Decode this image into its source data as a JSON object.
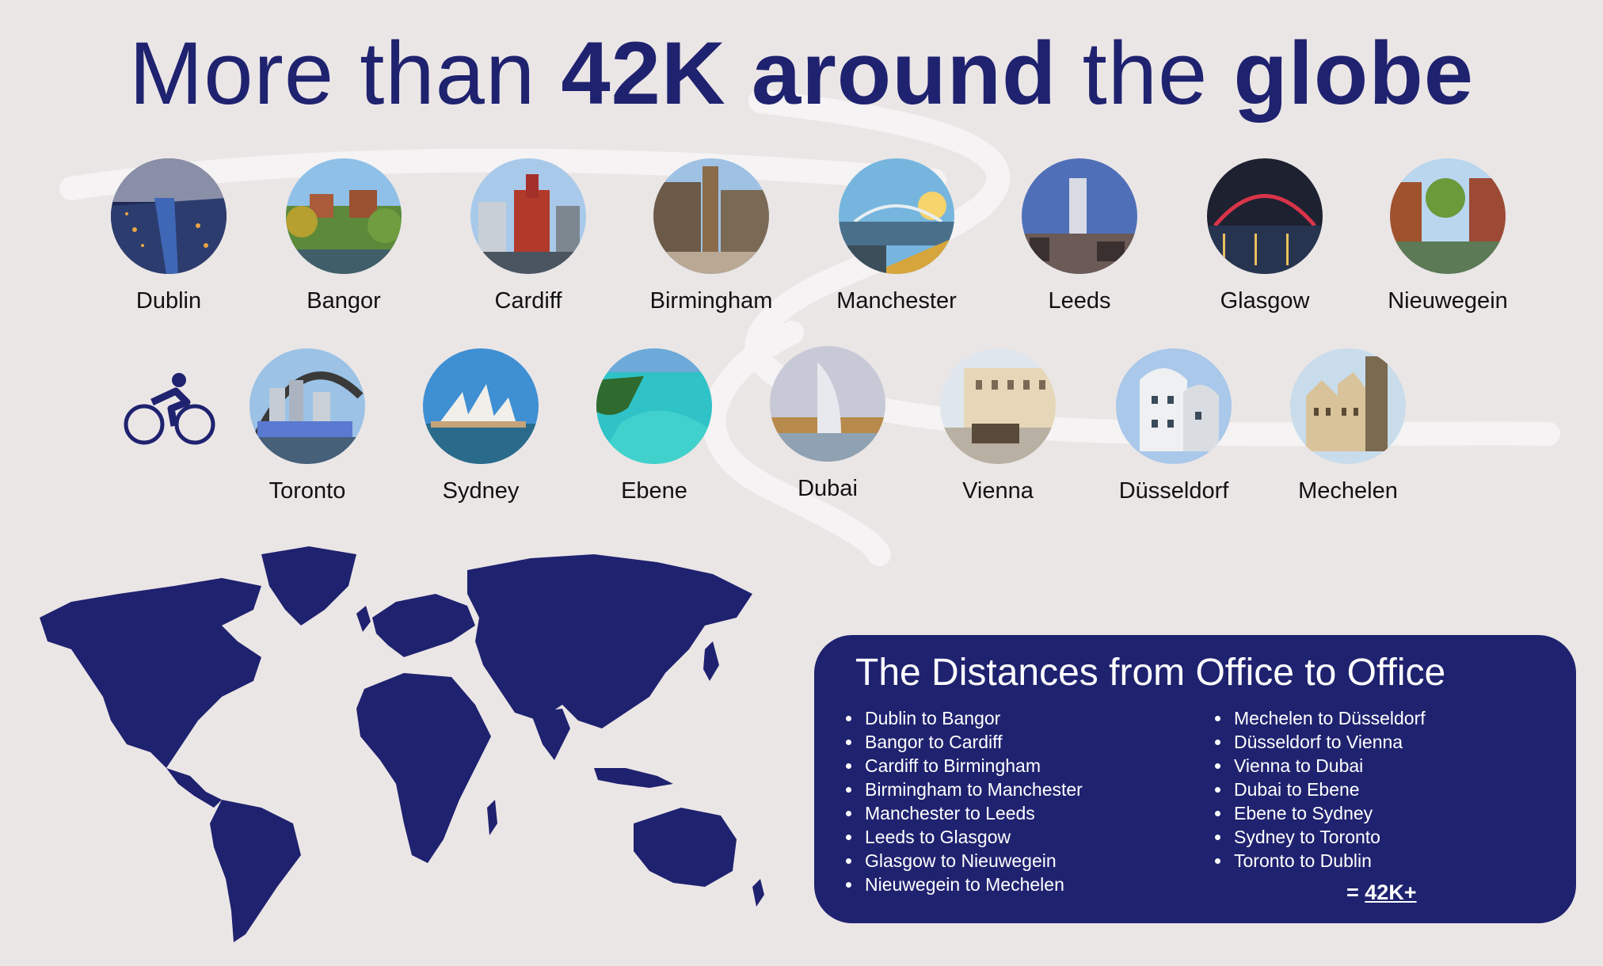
{
  "header": {
    "part1": "More than ",
    "bold1": "42K around",
    "part2": " the ",
    "bold2": "globe"
  },
  "cities_row1": [
    {
      "label": "Dublin",
      "photo": "dublin-photo"
    },
    {
      "label": "Bangor",
      "photo": "bangor-photo"
    },
    {
      "label": "Cardiff",
      "photo": "cardiff-photo"
    },
    {
      "label": "Birmingham",
      "photo": "birmingham-photo"
    },
    {
      "label": "Manchester",
      "photo": "manchester-photo"
    },
    {
      "label": "Leeds",
      "photo": "leeds-photo"
    },
    {
      "label": "Glasgow",
      "photo": "glasgow-photo"
    },
    {
      "label": "Nieuwegein",
      "photo": "nieuwegein-photo"
    }
  ],
  "cities_row2": [
    {
      "label": "Toronto",
      "photo": "toronto-photo"
    },
    {
      "label": "Sydney",
      "photo": "sydney-photo"
    },
    {
      "label": "Ebene",
      "photo": "ebene-photo"
    },
    {
      "label": "Dubai",
      "photo": "dubai-photo"
    },
    {
      "label": "Vienna",
      "photo": "vienna-photo"
    },
    {
      "label": "Düsseldorf",
      "photo": "dusseldorf-photo"
    },
    {
      "label": "Mechelen",
      "photo": "mechelen-photo"
    }
  ],
  "icons": {
    "cyclist": "cyclist-icon",
    "map": "world-map-icon"
  },
  "colors": {
    "navy": "#1f226f",
    "background": "#ebe6e6",
    "text": "#111111"
  },
  "panel": {
    "title": "The Distances from Office to Office",
    "left_items": [
      "Dublin to Bangor",
      "Bangor to Cardiff",
      "Cardiff to Birmingham",
      "Birmingham to Manchester",
      "Manchester to Leeds",
      "Leeds to Glasgow",
      "Glasgow to Nieuwegein",
      "Nieuwegein to Mechelen"
    ],
    "right_items": [
      "Mechelen to Düsseldorf",
      "Düsseldorf to Vienna",
      "Vienna to Dubai",
      "Dubai to Ebene",
      "Ebene to Sydney",
      "Sydney to Toronto",
      "Toronto to Dublin"
    ],
    "total_prefix": "= ",
    "total_value": "42K+"
  }
}
